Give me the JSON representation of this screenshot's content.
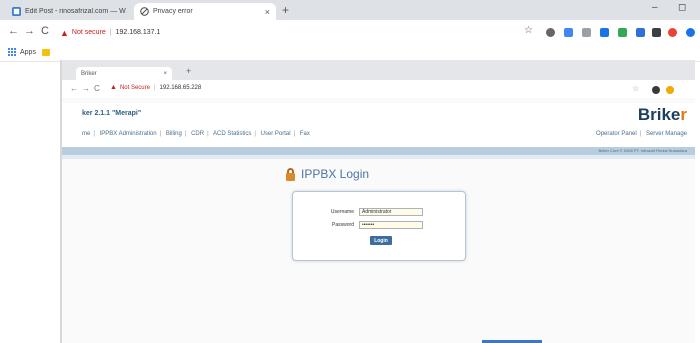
{
  "browser": {
    "tabs": [
      {
        "label": "Edit Post - rinosafrizal.com — W",
        "active": false,
        "icon": "wordpress-favicon-icon"
      },
      {
        "label": "Privacy error",
        "active": true,
        "icon": "privacy-error-icon"
      }
    ],
    "close_glyph": "×",
    "new_tab_glyph": "+",
    "window_controls": {
      "minimize": "–",
      "maximize": "◻"
    },
    "nav": {
      "back": "←",
      "forward": "→",
      "reload": "C"
    },
    "address": {
      "security_label": "Not secure",
      "separator": "|",
      "url": "192.168.137.1"
    },
    "bookmarks": {
      "apps_label": "Apps"
    }
  },
  "inner_browser": {
    "tab_label": "Briker",
    "close_glyph": "×",
    "new_tab_glyph": "+",
    "nav": {
      "back": "←",
      "forward": "→",
      "reload": "C"
    },
    "address": {
      "security_label": "Not Secure",
      "url": "192.168.65.228"
    },
    "star_glyph": "☆"
  },
  "site": {
    "version_label": "ker 2.1.1 \"Merapi\"",
    "logo": {
      "main": "Brike",
      "accent": "r"
    },
    "nav_items": [
      "me",
      "IPPBX Administration",
      "Billing",
      "CDR",
      "ACD Statistics",
      "User Portal",
      "Fax"
    ],
    "nav_right": [
      "Operator Panel",
      "Server Manage"
    ],
    "copyright": "Briker Core © 2008 PT. Infrasolt Renial Nusantara"
  },
  "login": {
    "title": "IPPBX Login",
    "username_label": "Username",
    "username_value": "Administrator",
    "password_label": "Password",
    "password_value": "•••••••",
    "button_label": "Login"
  },
  "colors": {
    "not_secure": "#c5221f",
    "brand_blue": "#1d3f5e",
    "brand_orange": "#e07a10",
    "login_button": "#3d6d9e"
  }
}
